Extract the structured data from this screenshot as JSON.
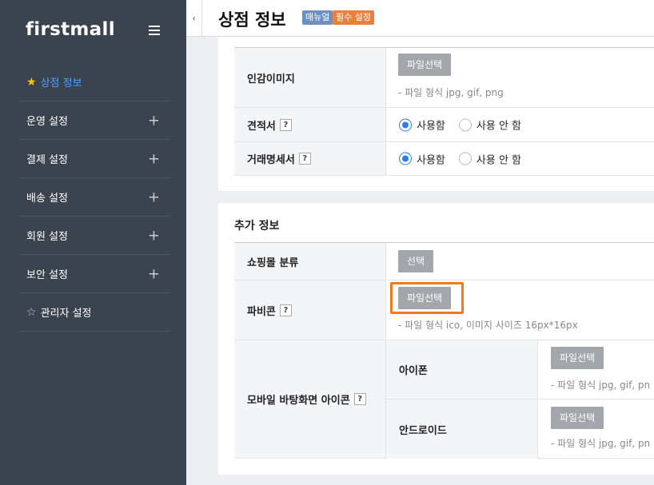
{
  "sidebar": {
    "logo": "firstmall",
    "items": [
      {
        "label": "상점 정보",
        "active": true,
        "icon": "star-filled-icon"
      },
      {
        "label": "운영 설정"
      },
      {
        "label": "결제 설정"
      },
      {
        "label": "배송 설정"
      },
      {
        "label": "회원 설정"
      },
      {
        "label": "보안 설정"
      },
      {
        "label": "관리자 설정",
        "icon": "star-outline-icon"
      }
    ],
    "expand_symbol": "+"
  },
  "header": {
    "collapse_icon": "‹",
    "title": "상점 정보",
    "badge_manual": "매뉴얼",
    "badge_required": "필수 설정"
  },
  "help_mark": "?",
  "section1": {
    "seal_image": {
      "label": "인감이미지",
      "button": "파일선택",
      "hint": "- 파일 형식 jpg, gif, png"
    },
    "estimate": {
      "label": "견적서",
      "option_use": "사용함",
      "option_not_use": "사용 안 함",
      "selected": "사용함"
    },
    "statement": {
      "label": "거래명세서",
      "option_use": "사용함",
      "option_not_use": "사용 안 함",
      "selected": "사용함"
    }
  },
  "section2": {
    "title": "추가 정보",
    "category": {
      "label": "쇼핑몰 분류",
      "button": "선택"
    },
    "favicon": {
      "label": "파비콘",
      "button": "파일선택",
      "hint": "- 파일 형식 ico, 이미지 사이즈 16px*16px"
    },
    "mobile_icon": {
      "label": "모바일 바탕화면 아이콘",
      "iphone": {
        "label": "아이폰",
        "button": "파일선택",
        "hint": "- 파일 형식 jpg, gif, pn"
      },
      "android": {
        "label": "안드로이드",
        "button": "파일선택",
        "hint": "- 파일 형식 jpg, gif, pn"
      }
    }
  },
  "colors": {
    "sidebar_bg": "#3b434f",
    "active_nav": "#4aa3ff",
    "highlight": "#f07a1c",
    "radio_checked": "#2b7de9"
  }
}
